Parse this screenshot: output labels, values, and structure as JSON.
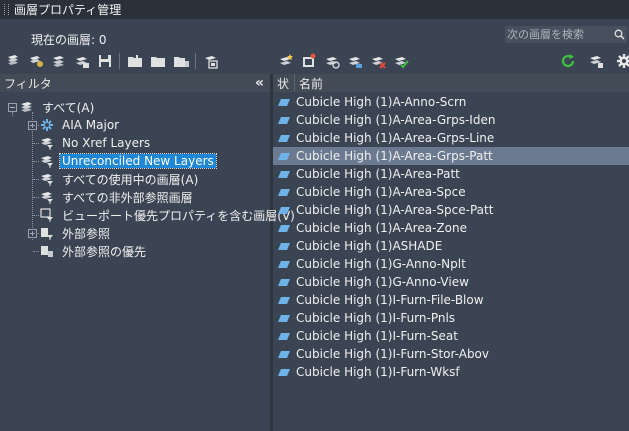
{
  "window": {
    "title": "画層プロパティ管理"
  },
  "status": {
    "current_layer": "現在の画層: 0"
  },
  "search": {
    "placeholder": "次の画層を検索"
  },
  "filter_panel": {
    "header": "フィルタ",
    "collapse_glyph": "«",
    "tree": [
      {
        "label": "すべて(A)",
        "icon": "all-layers-icon"
      },
      {
        "label": "AIA Major",
        "icon": "property-filter-icon"
      },
      {
        "label": "No Xref Layers",
        "icon": "filter-icon"
      },
      {
        "label": "Unreconciled New Layers",
        "icon": "filter-icon",
        "selected": true
      },
      {
        "label": "すべての使用中の画層(A)",
        "icon": "filter-icon"
      },
      {
        "label": "すべての非外部参照画層",
        "icon": "filter-icon"
      },
      {
        "label": "ビューポート優先プロパティを含む画層(V)",
        "icon": "viewport-filter-icon"
      },
      {
        "label": "外部参照",
        "icon": "xref-icon"
      },
      {
        "label": "外部参照の優先",
        "icon": "xref-override-icon"
      }
    ]
  },
  "layer_list": {
    "headers": {
      "state": "状",
      "name": "名前"
    },
    "rows": [
      "Cubicle High (1)A-Anno-Scrn",
      "Cubicle High (1)A-Area-Grps-Iden",
      "Cubicle High (1)A-Area-Grps-Line",
      "Cubicle High (1)A-Area-Grps-Patt",
      "Cubicle High (1)A-Area-Patt",
      "Cubicle High (1)A-Area-Spce",
      "Cubicle High (1)A-Area-Spce-Patt",
      "Cubicle High (1)A-Area-Zone",
      "Cubicle High (1)ASHADE",
      "Cubicle High (1)G-Anno-Nplt",
      "Cubicle High (1)G-Anno-View",
      "Cubicle High (1)I-Furn-File-Blow",
      "Cubicle High (1)I-Furn-Pnls",
      "Cubicle High (1)I-Furn-Seat",
      "Cubicle High (1)I-Furn-Stor-Abov",
      "Cubicle High (1)I-Furn-Wksf"
    ],
    "selected_index": 3
  },
  "colors": {
    "background": "#3b4453",
    "title_bar": "#2b313b",
    "selection": "#6b7a90",
    "tree_selection": "#1e88d6",
    "layer_icon": "#6fb2e8",
    "refresh_green": "#3fbf3f"
  }
}
